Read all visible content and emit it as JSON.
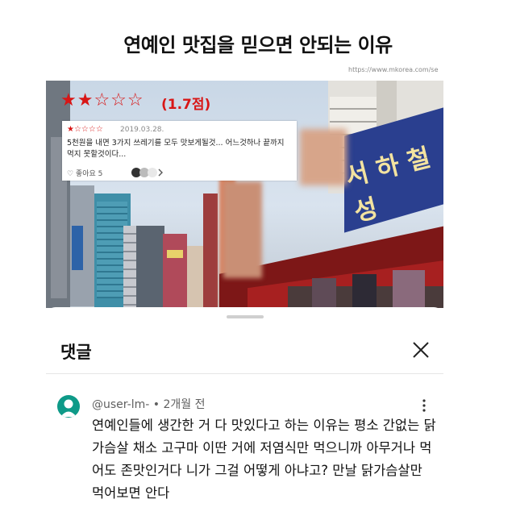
{
  "headline": "연예인 맛집을 믿으면 안되는 이유",
  "source_url": "https://www.mkorea.com/se",
  "photo": {
    "rating_stars": "★★☆☆☆",
    "rating_score": "(1.7점)",
    "review": {
      "stars": "★☆☆☆☆",
      "date": "2019.03.28.",
      "text": "5천원을 내면 3가지 쓰레기를 모두 맛보게될것... 어느것하나 끝까지 먹지 못할것이다...",
      "like_label": "♡ 좋아요 5"
    },
    "sign_text": "서 하 철 성"
  },
  "sheet": {
    "title": "댓글",
    "comment": {
      "author": "@user-lm-",
      "separator": "•",
      "time": "2개월 전",
      "text": "연예인들에 생간한 거 다 맛있다고 하는 이유는 평소 간없는 닭가슴살 채소 고구마 이딴 거에 저염식만 먹으니까 아무거나 먹어도 존맛인거다 니가 그걸 어떻게 아냐고? 만날 닭가슴살만 먹어보면 안다"
    }
  },
  "colors": {
    "accent_red": "#d81616",
    "avatar_teal": "#0e9a88"
  }
}
